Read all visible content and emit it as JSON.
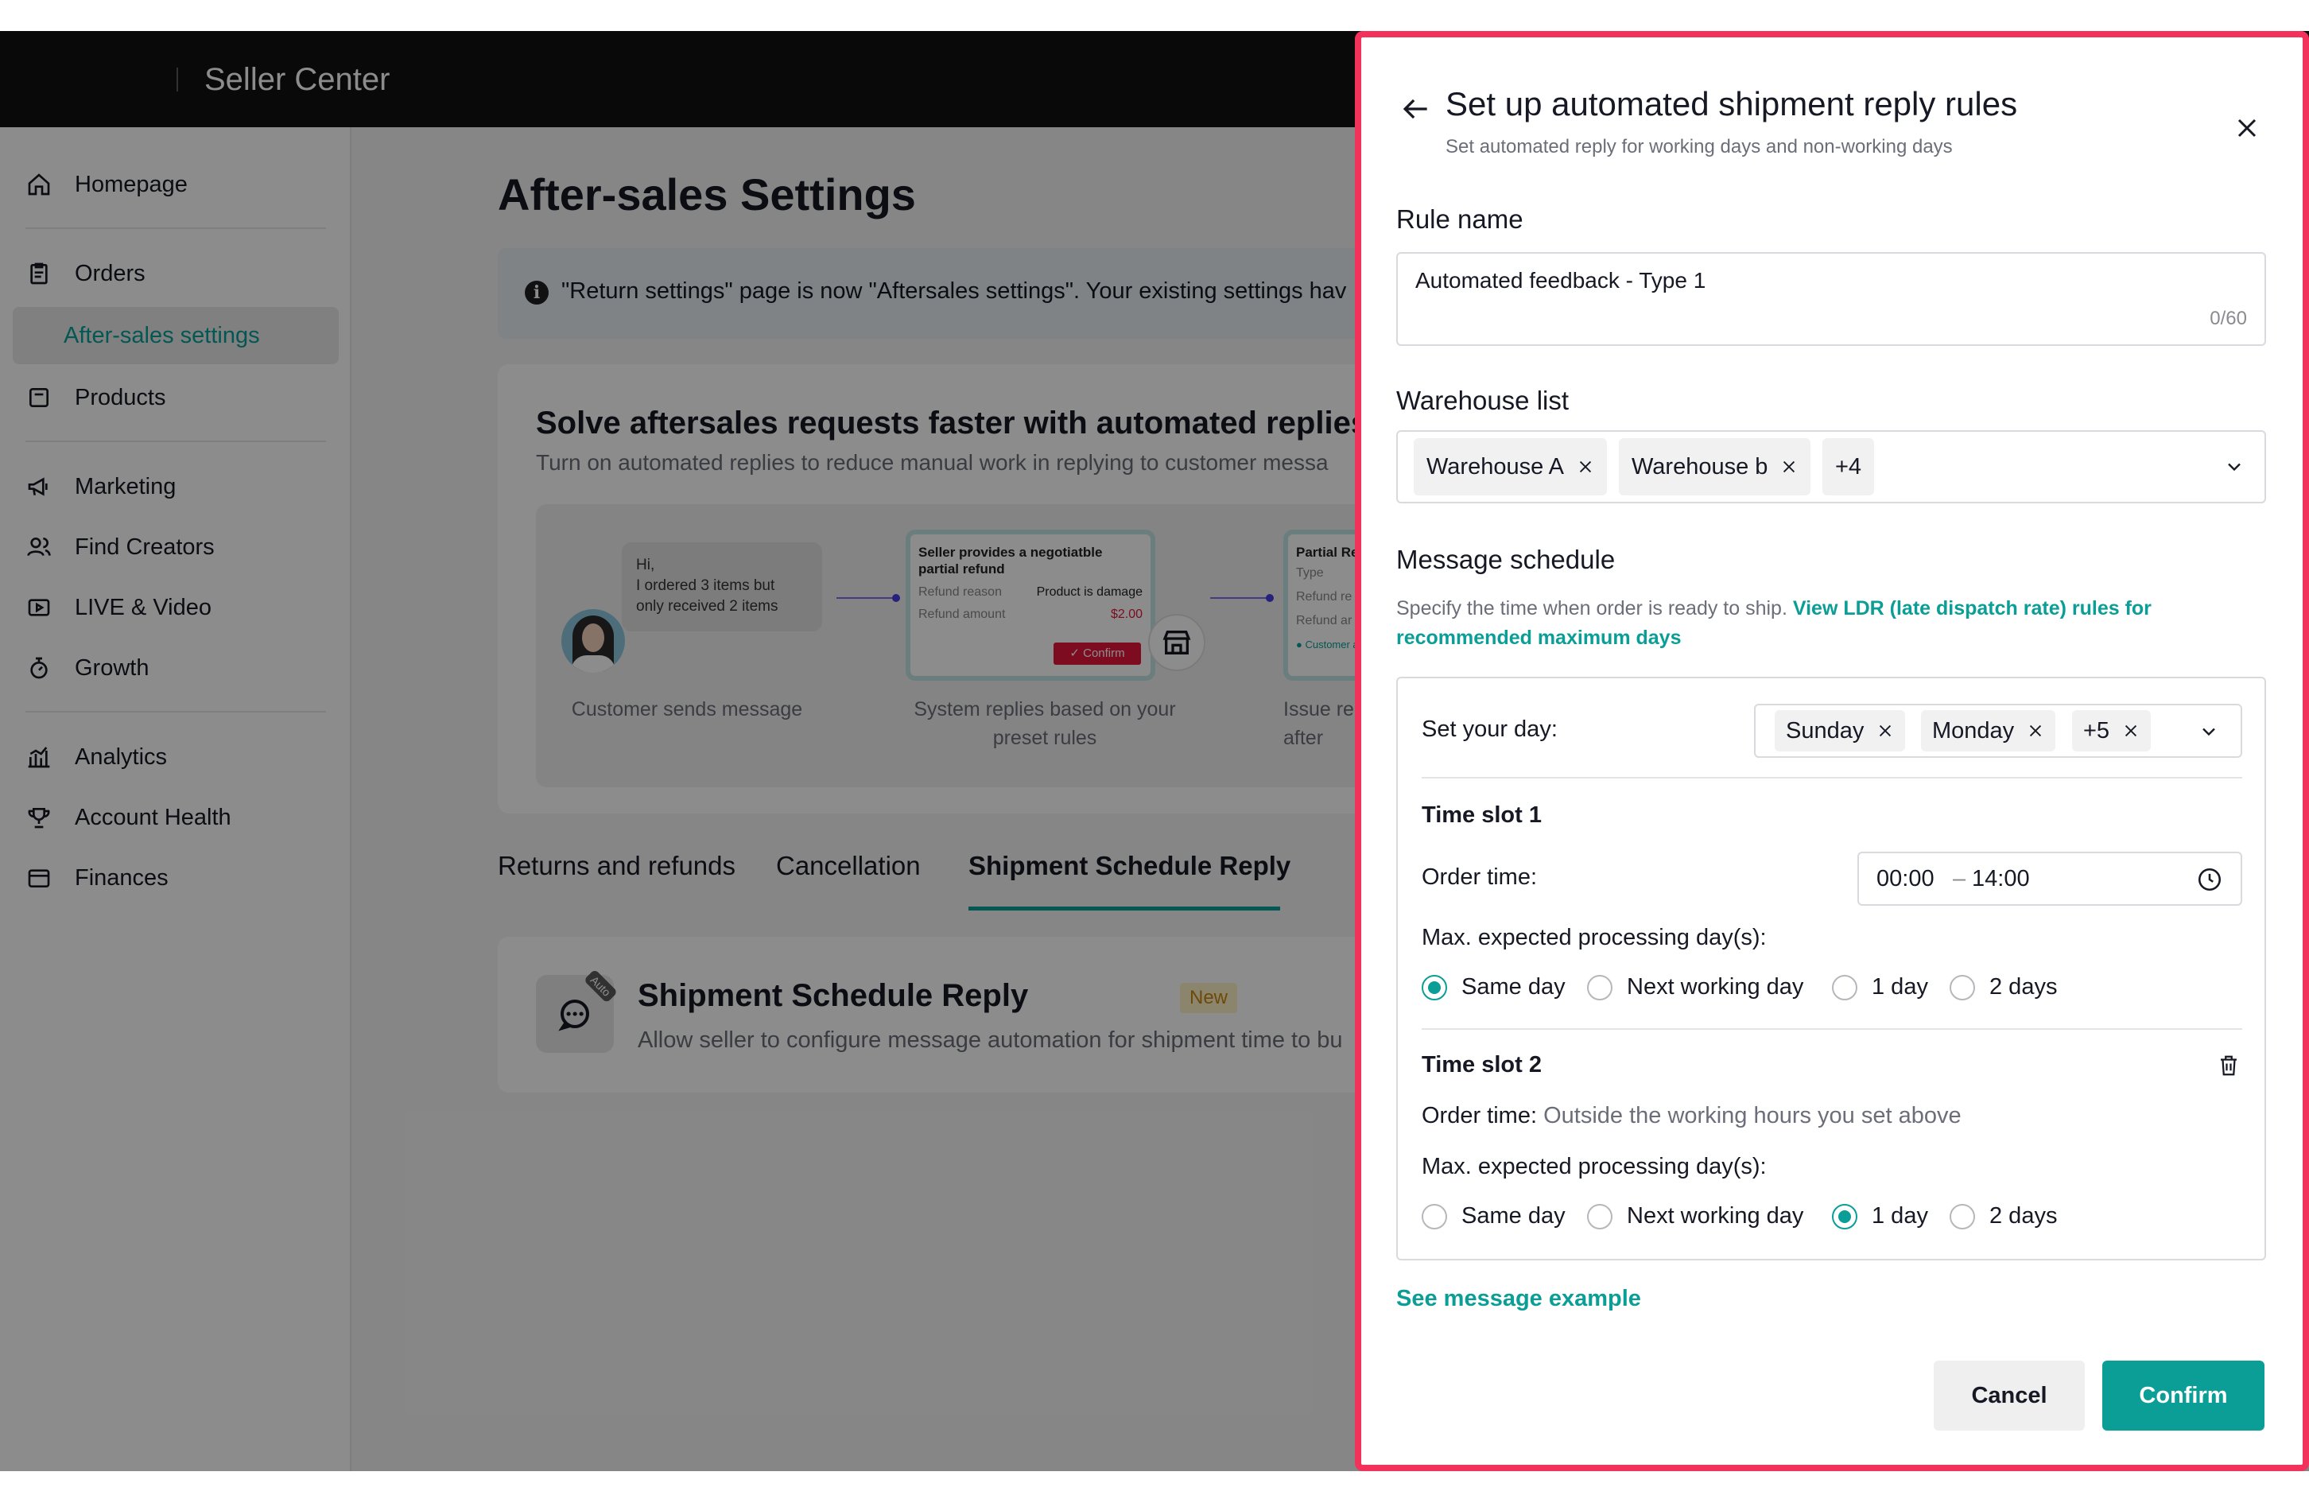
{
  "header": {
    "brand": "Seller Center"
  },
  "sidebar": {
    "items": [
      {
        "label": "Homepage",
        "icon": "home-icon"
      },
      {
        "label": "Orders",
        "icon": "clipboard-icon"
      },
      {
        "label": "After-sales settings",
        "sub": true,
        "active": true
      },
      {
        "label": "Products",
        "icon": "product-icon"
      },
      {
        "label": "Marketing",
        "icon": "megaphone-icon"
      },
      {
        "label": "Find Creators",
        "icon": "users-icon"
      },
      {
        "label": "LIVE & Video",
        "icon": "video-icon"
      },
      {
        "label": "Growth",
        "icon": "growth-icon"
      },
      {
        "label": "Analytics",
        "icon": "bar-chart-icon"
      },
      {
        "label": "Account Health",
        "icon": "trophy-icon"
      },
      {
        "label": "Finances",
        "icon": "wallet-icon"
      }
    ]
  },
  "main": {
    "title": "After-sales Settings",
    "banner": "\"Return settings\" page is now \"Aftersales settings\". Your existing settings hav",
    "promo": {
      "title": "Solve aftersales requests faster with automated replies",
      "subtitle": "Turn on automated replies to reduce manual work in replying to customer messa",
      "chat": {
        "line1": "Hi,",
        "line2": "I ordered 3 items but",
        "line3": "only received 2 items"
      },
      "reply_card": {
        "title": "Seller provides a negotiatble partial refund",
        "reason_label": "Refund reason",
        "reason_value": "Product is damage",
        "amount_label": "Refund amount",
        "amount_value": "$2.00",
        "confirm": "✓  Confirm"
      },
      "partial_card": {
        "title": "Partial Re",
        "row1": "Type",
        "row2": "Refund re",
        "row3": "Refund ar",
        "row4": "● Customer a"
      },
      "captions": {
        "step1": "Customer sends message",
        "step2": "System replies based on your preset rules",
        "step3": "Issue re after"
      }
    },
    "tabs": [
      "Returns and refunds",
      "Cancellation",
      "Shipment Schedule Reply"
    ],
    "feature": {
      "icon_badge": "Auto",
      "title": "Shipment Schedule Reply",
      "badge": "New",
      "subtitle": "Allow seller to configure message automation for shipment time to bu"
    }
  },
  "drawer": {
    "title": "Set up automated shipment reply rules",
    "subtitle": "Set automated reply for working days and non-working days",
    "rule_name": {
      "label": "Rule name",
      "value": "Automated feedback - Type 1",
      "count": "0/60"
    },
    "warehouse": {
      "label": "Warehouse list",
      "chips": [
        "Warehouse A",
        "Warehouse b"
      ],
      "more": "+4"
    },
    "schedule": {
      "label": "Message schedule",
      "desc": "Specify the time when order is ready to ship.",
      "link": "View LDR (late dispatch rate) rules for recommended maximum days",
      "day_label": "Set your day:",
      "day_chips": [
        "Sunday",
        "Monday"
      ],
      "day_more": "+5",
      "slot1": {
        "title": "Time slot 1",
        "order_label": "Order time:",
        "start": "00:00",
        "end": "14:00",
        "max_label": "Max. expected processing day(s):"
      },
      "slot2": {
        "title": "Time slot 2",
        "order_label": "Order time:",
        "order_value": "Outside the working hours you set above",
        "max_label": "Max. expected processing day(s):"
      },
      "options": [
        "Same day",
        "Next working day",
        "1 day",
        "2 days"
      ]
    },
    "see_example": "See message example",
    "cancel": "Cancel",
    "confirm": "Confirm"
  }
}
